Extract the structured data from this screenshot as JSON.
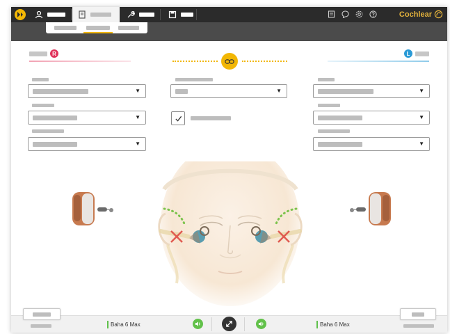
{
  "brand": {
    "name": "Cochlear"
  },
  "sides": {
    "right": {
      "badge": "R",
      "color": "#e0325a"
    },
    "left": {
      "badge": "L",
      "color": "#2a9ad6"
    }
  },
  "bottom": {
    "right_device_name": "Baha 6 Max",
    "left_device_name": "Baha 6 Max"
  },
  "colors": {
    "accent": "#f2b705",
    "topbar": "#2b2b2b",
    "subbar": "#4b4b4b",
    "right_side": "#e0325a",
    "left_side": "#2a9ad6",
    "sound_on": "#62c14a",
    "brand_text": "#e3b23c"
  },
  "icons": {
    "logo": "cochlear-arrow-logo-icon",
    "tab_patient": "person-icon",
    "tab_fitting": "document-icon",
    "tab_tools": "wrench-icon",
    "tab_session": "save-icon",
    "header": [
      "notes-icon",
      "chat-icon",
      "settings-icon",
      "help-icon"
    ],
    "link": "link-icon",
    "check": "check-icon",
    "sound": "speaker-icon",
    "center": "expand-arrows-icon"
  },
  "form": {
    "middle_checkbox_checked": true
  },
  "dropdown_caret": "▼"
}
